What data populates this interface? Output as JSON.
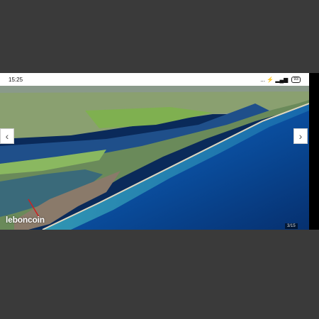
{
  "status_bar": {
    "time": "15:25",
    "icons_text": "... ⚡ ▂▄▆",
    "battery": "93"
  },
  "gallery": {
    "prev_glyph": "‹",
    "next_glyph": "›",
    "watermark": "leboncoin",
    "counter": "3/15",
    "photo_alt": "Aerial photo of coastline"
  },
  "colors": {
    "sea_deep": "#0a3f8f",
    "sea_shallow": "#2a8fb0",
    "lagoon": "#2a5a7f",
    "land_green": "#7aa85a",
    "sand": "#d8d0b0"
  }
}
